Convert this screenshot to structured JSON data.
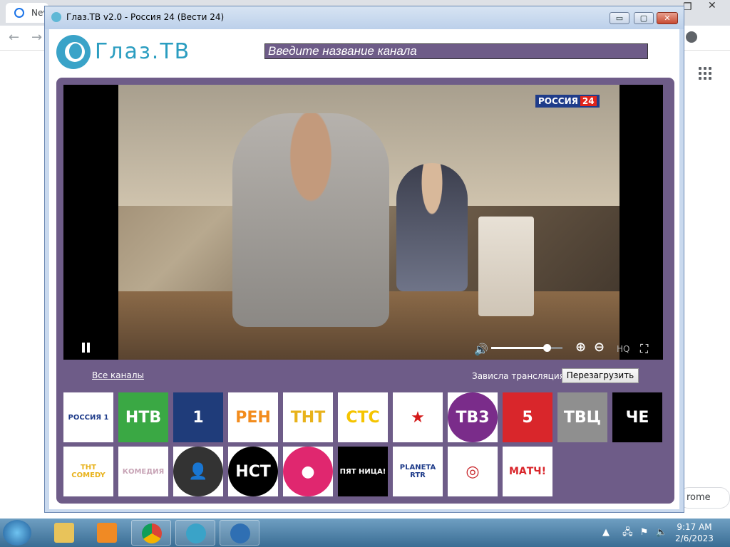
{
  "browser": {
    "tab_label": "Nev",
    "chrome_link_label": "rome"
  },
  "window": {
    "title": "Глаз.ТВ v2.0 - Россия 24 (Вести 24)",
    "controls": {
      "minimize": "▭",
      "maximize": "▢",
      "close": "✕"
    }
  },
  "header": {
    "logo_text": "Глаз.ТВ",
    "search_placeholder": "Введите название канала"
  },
  "player": {
    "channel_logo": "РОССИЯ",
    "channel_logo_num": "24",
    "quality_label": "HQ",
    "volume_level": 0.78
  },
  "controls": {
    "all_channels": "Все каналы",
    "stuck_question": "Зависла трансляция?",
    "reload_button": "Перезагрузить"
  },
  "channels": [
    {
      "name": "РОССИЯ 1",
      "bg": "#ffffff",
      "fg": "#1f3c8a",
      "shape": "rect"
    },
    {
      "name": "НТВ",
      "bg": "#3aa844",
      "fg": "#ffffff",
      "shape": "rect"
    },
    {
      "name": "1",
      "bg": "#1f3c7a",
      "fg": "#ffffff",
      "shape": "rect"
    },
    {
      "name": "РЕН",
      "bg": "#ffffff",
      "fg": "#f28c1e",
      "shape": "rect"
    },
    {
      "name": "ТНТ",
      "bg": "#ffffff",
      "fg": "#e8b21b",
      "shape": "rect"
    },
    {
      "name": "СТС",
      "bg": "#ffffff",
      "fg": "#f5c400",
      "shape": "rect"
    },
    {
      "name": "★",
      "bg": "#ffffff",
      "fg": "#d41a1a",
      "shape": "rect"
    },
    {
      "name": "ТВ3",
      "bg": "#7a2c8a",
      "fg": "#ffffff",
      "shape": "circle"
    },
    {
      "name": "5",
      "bg": "#d9262b",
      "fg": "#ffffff",
      "shape": "rect"
    },
    {
      "name": "ТВЦ",
      "bg": "#8f8f8f",
      "fg": "#ffffff",
      "shape": "rect"
    },
    {
      "name": "ЧЕ",
      "bg": "#000000",
      "fg": "#ffffff",
      "shape": "rect"
    },
    {
      "name": "ТНТ COMEDY",
      "bg": "#ffffff",
      "fg": "#e8b21b",
      "shape": "rect"
    },
    {
      "name": "КОМЕДИЯ",
      "bg": "#ffffff",
      "fg": "#c7a3b5",
      "shape": "rect"
    },
    {
      "name": "👤",
      "bg": "#333333",
      "fg": "#cccccc",
      "shape": "circle"
    },
    {
      "name": "НСТ",
      "bg": "#000000",
      "fg": "#ffffff",
      "shape": "circle"
    },
    {
      "name": "●",
      "bg": "#e0276f",
      "fg": "#ffffff",
      "shape": "circle"
    },
    {
      "name": "ПЯТ НИЦА!",
      "bg": "#000000",
      "fg": "#ffffff",
      "shape": "rect"
    },
    {
      "name": "PLANETA RTR",
      "bg": "#ffffff",
      "fg": "#1f3c8a",
      "shape": "rect"
    },
    {
      "name": "◎",
      "bg": "#ffffff",
      "fg": "#c8262b",
      "shape": "rect"
    },
    {
      "name": "МАТЧ!",
      "bg": "#ffffff",
      "fg": "#d9262b",
      "shape": "rect"
    }
  ],
  "taskbar": {
    "time": "9:17 AM",
    "date": "2/6/2023",
    "tray_arrow": "▲"
  }
}
